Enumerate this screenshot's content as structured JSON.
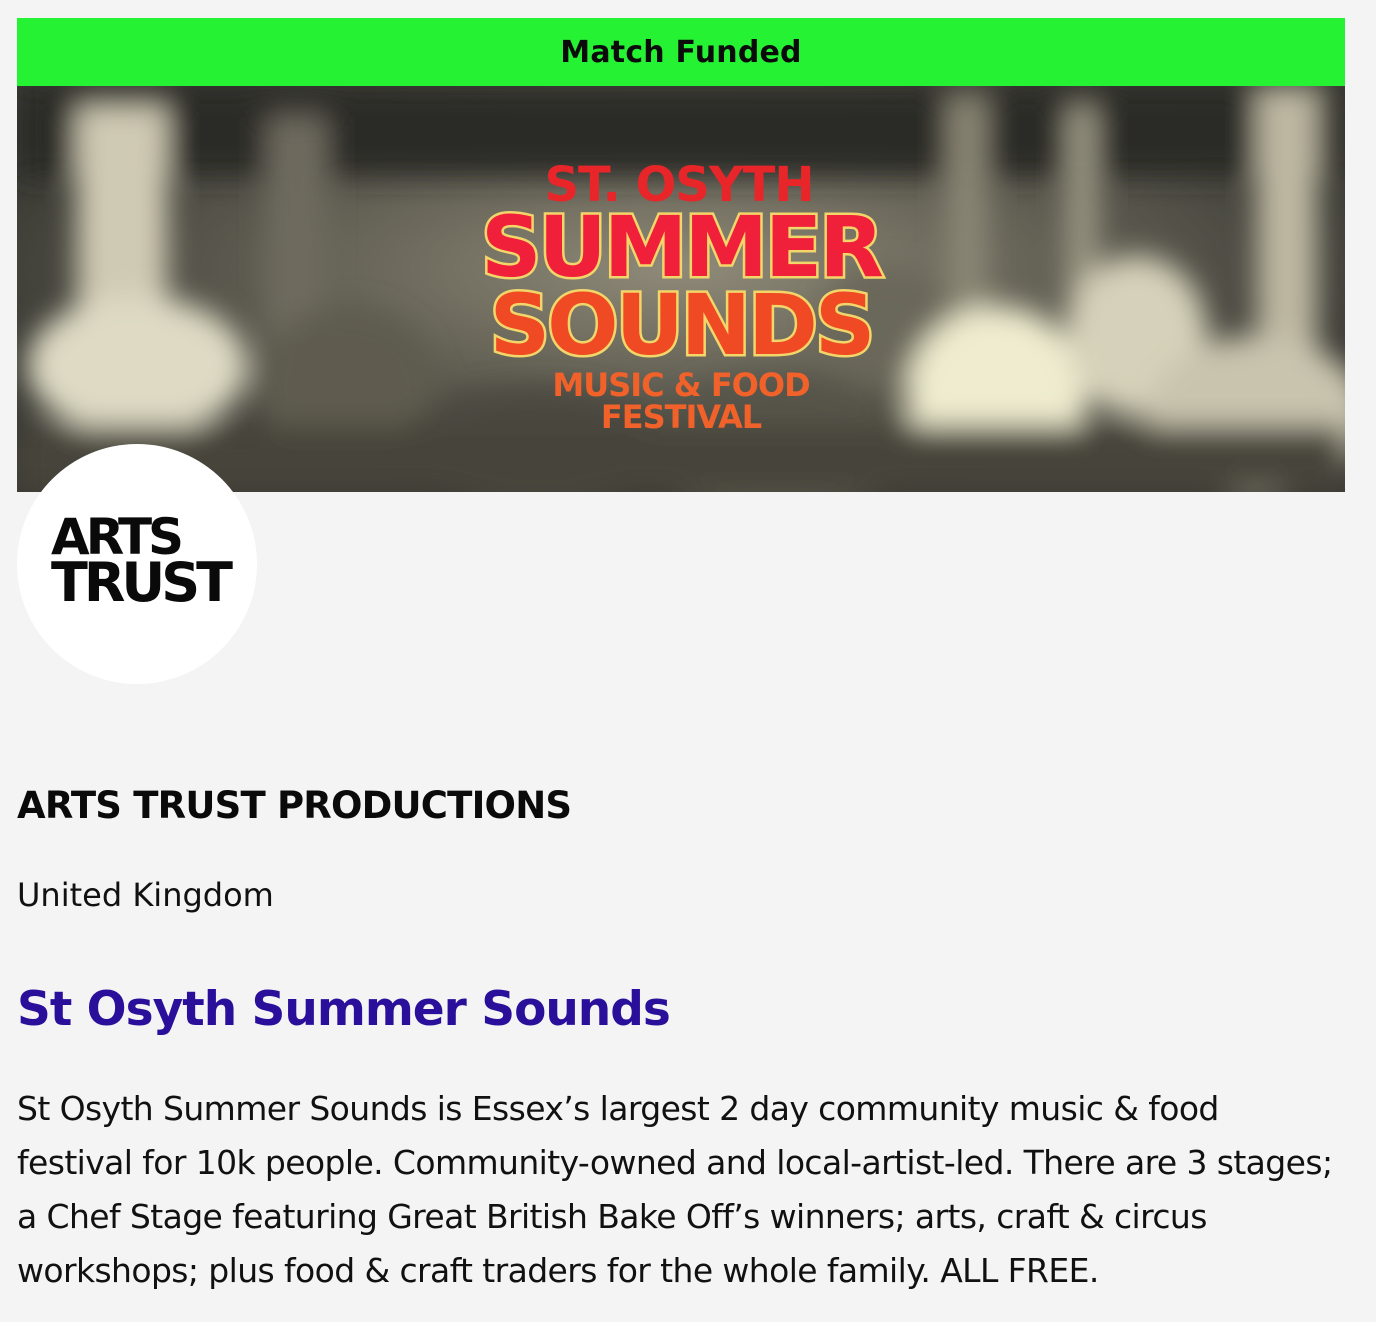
{
  "badge": {
    "label": "Match Funded",
    "color": "#26f234"
  },
  "banner": {
    "poster_line1": "ST. OSYTH",
    "poster_line2": "SUMMER",
    "poster_line3": "SOUNDS",
    "poster_line4": "MUSIC & FOOD",
    "poster_line5": "FESTIVAL"
  },
  "org_logo": {
    "line1": "ARTS",
    "line2": "TRUST"
  },
  "organisation": {
    "name": "ARTS TRUST PRODUCTIONS",
    "country": "United Kingdom"
  },
  "project": {
    "title": "St Osyth Summer Sounds",
    "title_color": "#2a0f9a",
    "description": "St Osyth Summer Sounds is Essex’s largest 2 day community music & food festival for 10k people. Community-owned and local-artist-led. There are 3 stages; a Chef Stage featuring Great British Bake Off’s winners; arts, craft & circus workshops; plus food & craft traders for the whole family. ALL FREE."
  }
}
